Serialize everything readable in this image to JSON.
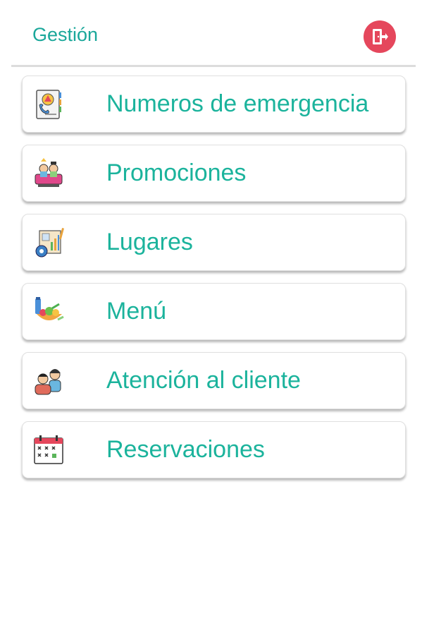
{
  "header": {
    "title": "Gestión",
    "logout_icon": "logout-door-icon",
    "accent_color": "#1aa79a",
    "logout_color": "#e5475c"
  },
  "menu": {
    "items": [
      {
        "label": "Numeros de emergencia",
        "icon": "emergency-phonebook-icon"
      },
      {
        "label": "Promociones",
        "icon": "promotions-party-icon"
      },
      {
        "label": "Lugares",
        "icon": "places-map-icon"
      },
      {
        "label": "Menú",
        "icon": "food-menu-icon"
      },
      {
        "label": "Atención al cliente",
        "icon": "customer-service-icon"
      },
      {
        "label": "Reservaciones",
        "icon": "calendar-reservations-icon"
      }
    ]
  }
}
